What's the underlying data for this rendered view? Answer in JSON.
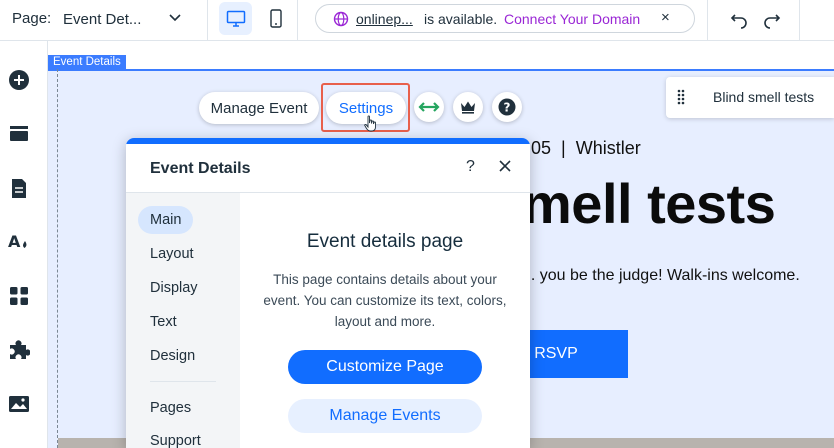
{
  "topbar": {
    "page_label": "Page:",
    "page_value": "Event Det...",
    "domain_name": "onlinep...",
    "domain_status": "is available.",
    "connect_link": "Connect Your Domain",
    "close_symbol": "×",
    "icons": [
      "chevron-down-icon",
      "desktop-icon",
      "mobile-icon",
      "globe-icon",
      "undo-icon",
      "redo-icon"
    ]
  },
  "sidebar": {
    "icons": [
      "add-icon",
      "sections-icon",
      "pages-icon",
      "theme-icon",
      "apps-icon",
      "app-market-icon",
      "media-icon"
    ]
  },
  "canvas": {
    "section_tag": "Event Details",
    "event_date": "05  |  Whistler",
    "event_title": "mell tests",
    "event_description": "... you be the judge! Walk-ins welcome.",
    "rsvp_label": "RSVP"
  },
  "toolbar": {
    "manage_event": "Manage Event",
    "settings": "Settings",
    "icons": [
      "stretch-icon",
      "upgrade-crown-icon",
      "help-icon"
    ]
  },
  "layer_chip": {
    "label": "Blind smell tests"
  },
  "panel": {
    "title": "Event Details",
    "help": "?",
    "nav": [
      "Main",
      "Layout",
      "Display",
      "Text",
      "Design",
      "Pages",
      "Support"
    ],
    "body_title": "Event details page",
    "body_text": "This page contains details about your event. You can customize its text, colors, layout and more.",
    "primary_button": "Customize Page",
    "secondary_button": "Manage Events"
  },
  "colors": {
    "accent": "#116dff",
    "section_bg": "#e7eeff",
    "highlight_outline": "#e8604c",
    "connect_purple": "#9a27d5",
    "stretch_green": "#25a55f"
  }
}
